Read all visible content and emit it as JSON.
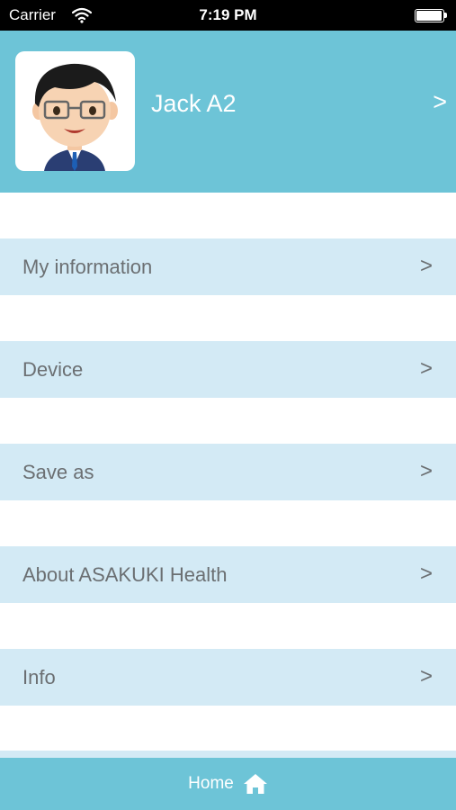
{
  "status_bar": {
    "carrier": "Carrier",
    "time": "7:19 PM",
    "wifi_icon": "wifi-icon",
    "battery_icon": "battery-icon"
  },
  "profile": {
    "name": "Jack A2",
    "chevron": ">",
    "avatar_icon": "user-avatar"
  },
  "menu": {
    "items": [
      {
        "label": "My information",
        "chevron": ">"
      },
      {
        "label": "Device",
        "chevron": ">"
      },
      {
        "label": "Save as",
        "chevron": ">"
      },
      {
        "label": "About ASAKUKI Health",
        "chevron": ">"
      },
      {
        "label": "Info",
        "chevron": ">"
      }
    ]
  },
  "tabbar": {
    "home_label": "Home",
    "home_icon": "home-icon"
  },
  "colors": {
    "header_bg": "#6dc4d7",
    "row_bg": "#d3eaf5",
    "row_text": "#6b6f72",
    "status_bar_bg": "#000000"
  }
}
